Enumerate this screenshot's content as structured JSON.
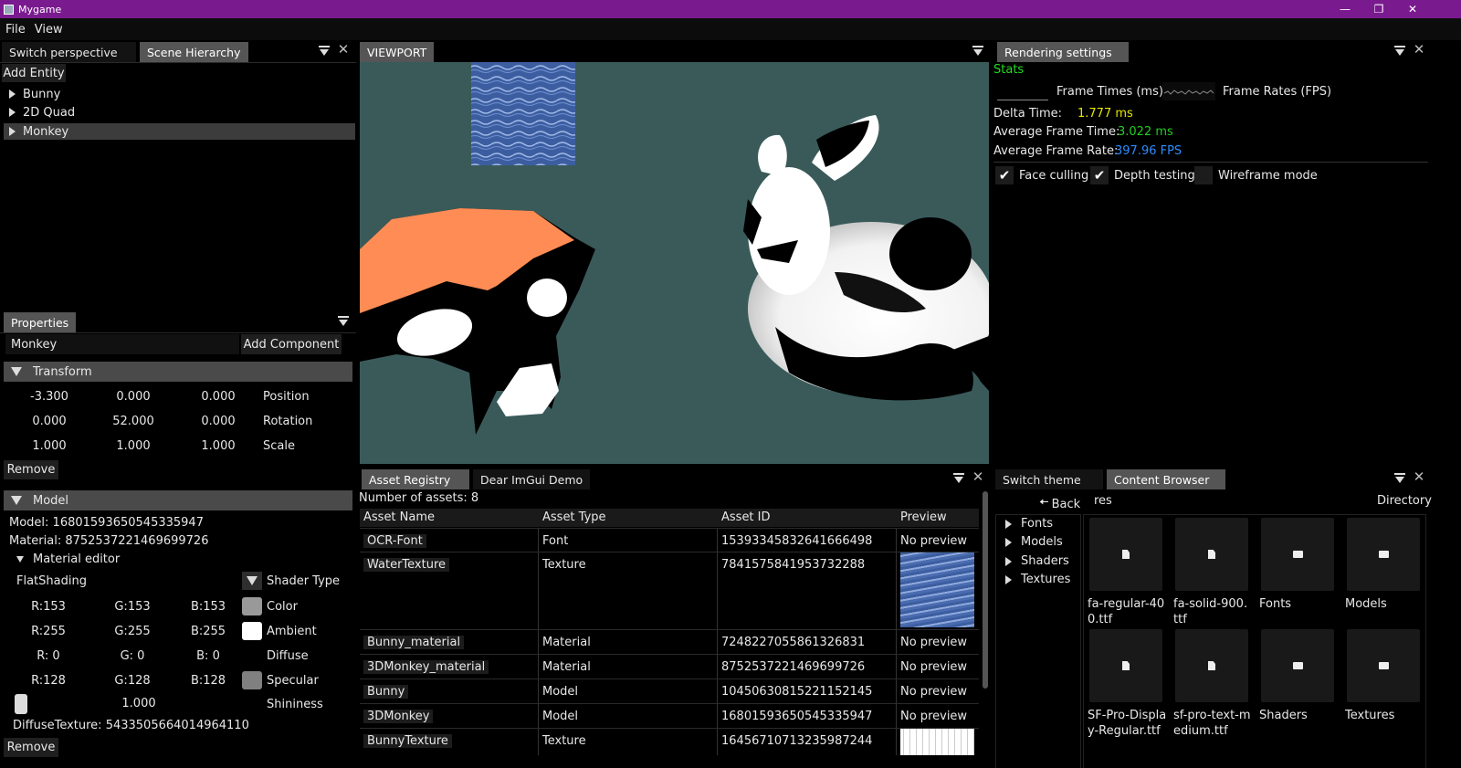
{
  "window": {
    "title": "Mygame"
  },
  "menu": [
    "File",
    "View"
  ],
  "left_top": {
    "tabs": [
      "Switch perspective",
      "Scene Hierarchy"
    ],
    "add_entity": "Add Entity",
    "entities": [
      "Bunny",
      "2D Quad",
      "Monkey"
    ]
  },
  "properties": {
    "tab": "Properties",
    "entity_name": "Monkey",
    "add_component": "Add Component",
    "transform": {
      "header": "Transform",
      "rows": [
        {
          "vals": [
            "-3.300",
            "0.000",
            "0.000"
          ],
          "label": "Position"
        },
        {
          "vals": [
            "0.000",
            "52.000",
            "0.000"
          ],
          "label": "Rotation"
        },
        {
          "vals": [
            "1.000",
            "1.000",
            "1.000"
          ],
          "label": "Scale"
        }
      ],
      "remove": "Remove"
    },
    "model": {
      "header": "Model",
      "model_line": "Model: 16801593650545335947",
      "material_line": "Material: 8752537221469699726",
      "material_editor": "Material editor",
      "shader_value": "FlatShading",
      "shader_label": "Shader Type",
      "colors": [
        {
          "r": "R:153",
          "g": "G:153",
          "b": "B:153",
          "label": "Color",
          "hex": "#999999"
        },
        {
          "r": "R:255",
          "g": "G:255",
          "b": "B:255",
          "label": "Ambient",
          "hex": "#ffffff"
        },
        {
          "r": "R:  0",
          "g": "G:  0",
          "b": "B:  0",
          "label": "Diffuse",
          "hex": "#000000"
        },
        {
          "r": "R:128",
          "g": "G:128",
          "b": "B:128",
          "label": "Specular",
          "hex": "#808080"
        }
      ],
      "shininess_value": "1.000",
      "shininess_label": "Shininess",
      "diffuse_texture": "DiffuseTexture: 5433505664014964110",
      "remove": "Remove"
    }
  },
  "viewport": {
    "tab": "VIEWPORT"
  },
  "rendering": {
    "tab": "Rendering settings",
    "stats": "Stats",
    "frame_times": "Frame Times (ms)",
    "frame_rates": "Frame Rates (FPS)",
    "delta_label": "Delta Time:",
    "delta_value": "1.777 ms",
    "avg_ft_label": "Average Frame Time:",
    "avg_ft_value": "3.022 ms",
    "avg_fr_label": "Average Frame Rate:",
    "avg_fr_value": "397.96 FPS",
    "face_culling": "Face culling",
    "depth_testing": "Depth testing",
    "wireframe": "Wireframe mode"
  },
  "assets": {
    "tabs": [
      "Asset Registry",
      "Dear ImGui Demo"
    ],
    "count": "Number of assets: 8",
    "columns": [
      "Asset Name",
      "Asset Type",
      "Asset ID",
      "Preview"
    ],
    "rows": [
      {
        "name": "OCR-Font",
        "type": "Font",
        "id": "15393345832641666498",
        "preview": "No preview"
      },
      {
        "name": "WaterTexture",
        "type": "Texture",
        "id": "7841575841953732288",
        "preview": ""
      },
      {
        "name": "Bunny_material",
        "type": "Material",
        "id": "7248227055861326831",
        "preview": "No preview"
      },
      {
        "name": "3DMonkey_material",
        "type": "Material",
        "id": "8752537221469699726",
        "preview": "No preview"
      },
      {
        "name": "Bunny",
        "type": "Model",
        "id": "10450630815221152145",
        "preview": "No preview"
      },
      {
        "name": "3DMonkey",
        "type": "Model",
        "id": "16801593650545335947",
        "preview": "No preview"
      },
      {
        "name": "BunnyTexture",
        "type": "Texture",
        "id": "16456710713235987244",
        "preview": ""
      }
    ]
  },
  "content": {
    "tabs": [
      "Switch theme",
      "Content Browser"
    ],
    "back": "Back",
    "path": "res",
    "directory": "Directory",
    "folders": [
      "Fonts",
      "Models",
      "Shaders",
      "Textures"
    ],
    "items": [
      {
        "label": "fa-regular-40\n0.ttf",
        "icon": "file-icon"
      },
      {
        "label": "fa-solid-900.\nttf",
        "icon": "file-icon"
      },
      {
        "label": "Fonts",
        "icon": "folder-icon"
      },
      {
        "label": "Models",
        "icon": "folder-icon"
      },
      {
        "label": "SF-Pro-Displa\ny-Regular.ttf",
        "icon": "file-icon"
      },
      {
        "label": "sf-pro-text-m\nedium.ttf",
        "icon": "file-icon"
      },
      {
        "label": "Shaders",
        "icon": "folder-icon"
      },
      {
        "label": "Textures",
        "icon": "folder-icon"
      }
    ]
  },
  "colors": {
    "titlebar": "#7a1a8f",
    "stats": "#22dd22",
    "delta": "#e6e600",
    "avgft": "#22cc22",
    "avgfr": "#2d8cff"
  }
}
